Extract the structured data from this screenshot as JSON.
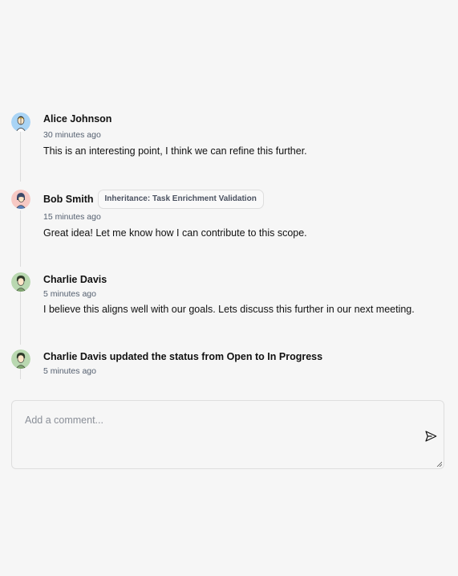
{
  "comments": [
    {
      "author": "Alice Johnson",
      "time": "30 minutes ago",
      "text": "This is an interesting point, I think we can refine this further.",
      "avatar_icon": "avatar-alice-icon",
      "avatar_bg": "#a9d4f5"
    },
    {
      "author": "Bob Smith",
      "tag": "Inheritance: Task Enrichment Validation",
      "time": "15 minutes ago",
      "text": "Great idea! Let me know how I can contribute to this scope.",
      "avatar_icon": "avatar-bob-icon",
      "avatar_bg": "#f7c9c4"
    },
    {
      "author": "Charlie Davis",
      "time": "5 minutes ago",
      "text": "I believe this aligns well with our goals. Lets discuss this further in our next meeting.",
      "avatar_icon": "avatar-charlie-icon",
      "avatar_bg": "#b9d8b0"
    }
  ],
  "activity": {
    "actor": "Charlie Davis",
    "action": "updated the status from",
    "from_status": "Open",
    "connector": "to",
    "to_status": "In Progress",
    "time": "5 minutes ago",
    "avatar_icon": "avatar-charlie-icon"
  },
  "composer": {
    "placeholder": "Add a comment...",
    "send_icon": "send-icon"
  }
}
